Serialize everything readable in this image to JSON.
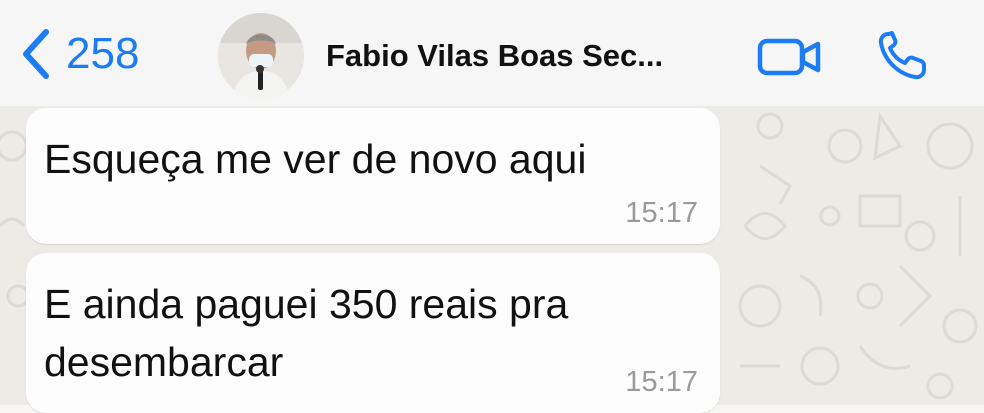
{
  "header": {
    "back_count": "258",
    "contact_name": "Fabio Vilas Boas Sec...",
    "icons": {
      "back": "chevron-left-icon",
      "video": "video-camera-icon",
      "call": "phone-icon"
    },
    "accent_color": "#1b7cf3"
  },
  "messages": [
    {
      "text": "Esqueça me ver de novo aqui",
      "time": "15:17"
    },
    {
      "text": "E ainda paguei 350 reais pra desembarcar",
      "time": "15:17"
    }
  ]
}
